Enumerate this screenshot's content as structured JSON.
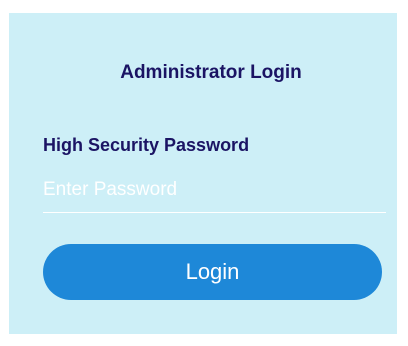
{
  "login_form": {
    "title": "Administrator Login",
    "password_label": "High Security Password",
    "password_placeholder": "Enter Password",
    "password_value": "",
    "submit_label": "Login"
  },
  "colors": {
    "panel_background": "#cdeff7",
    "heading_text": "#1b1464",
    "button_background": "#1e88d8",
    "button_text": "#ffffff",
    "placeholder_text": "#ffffff"
  }
}
